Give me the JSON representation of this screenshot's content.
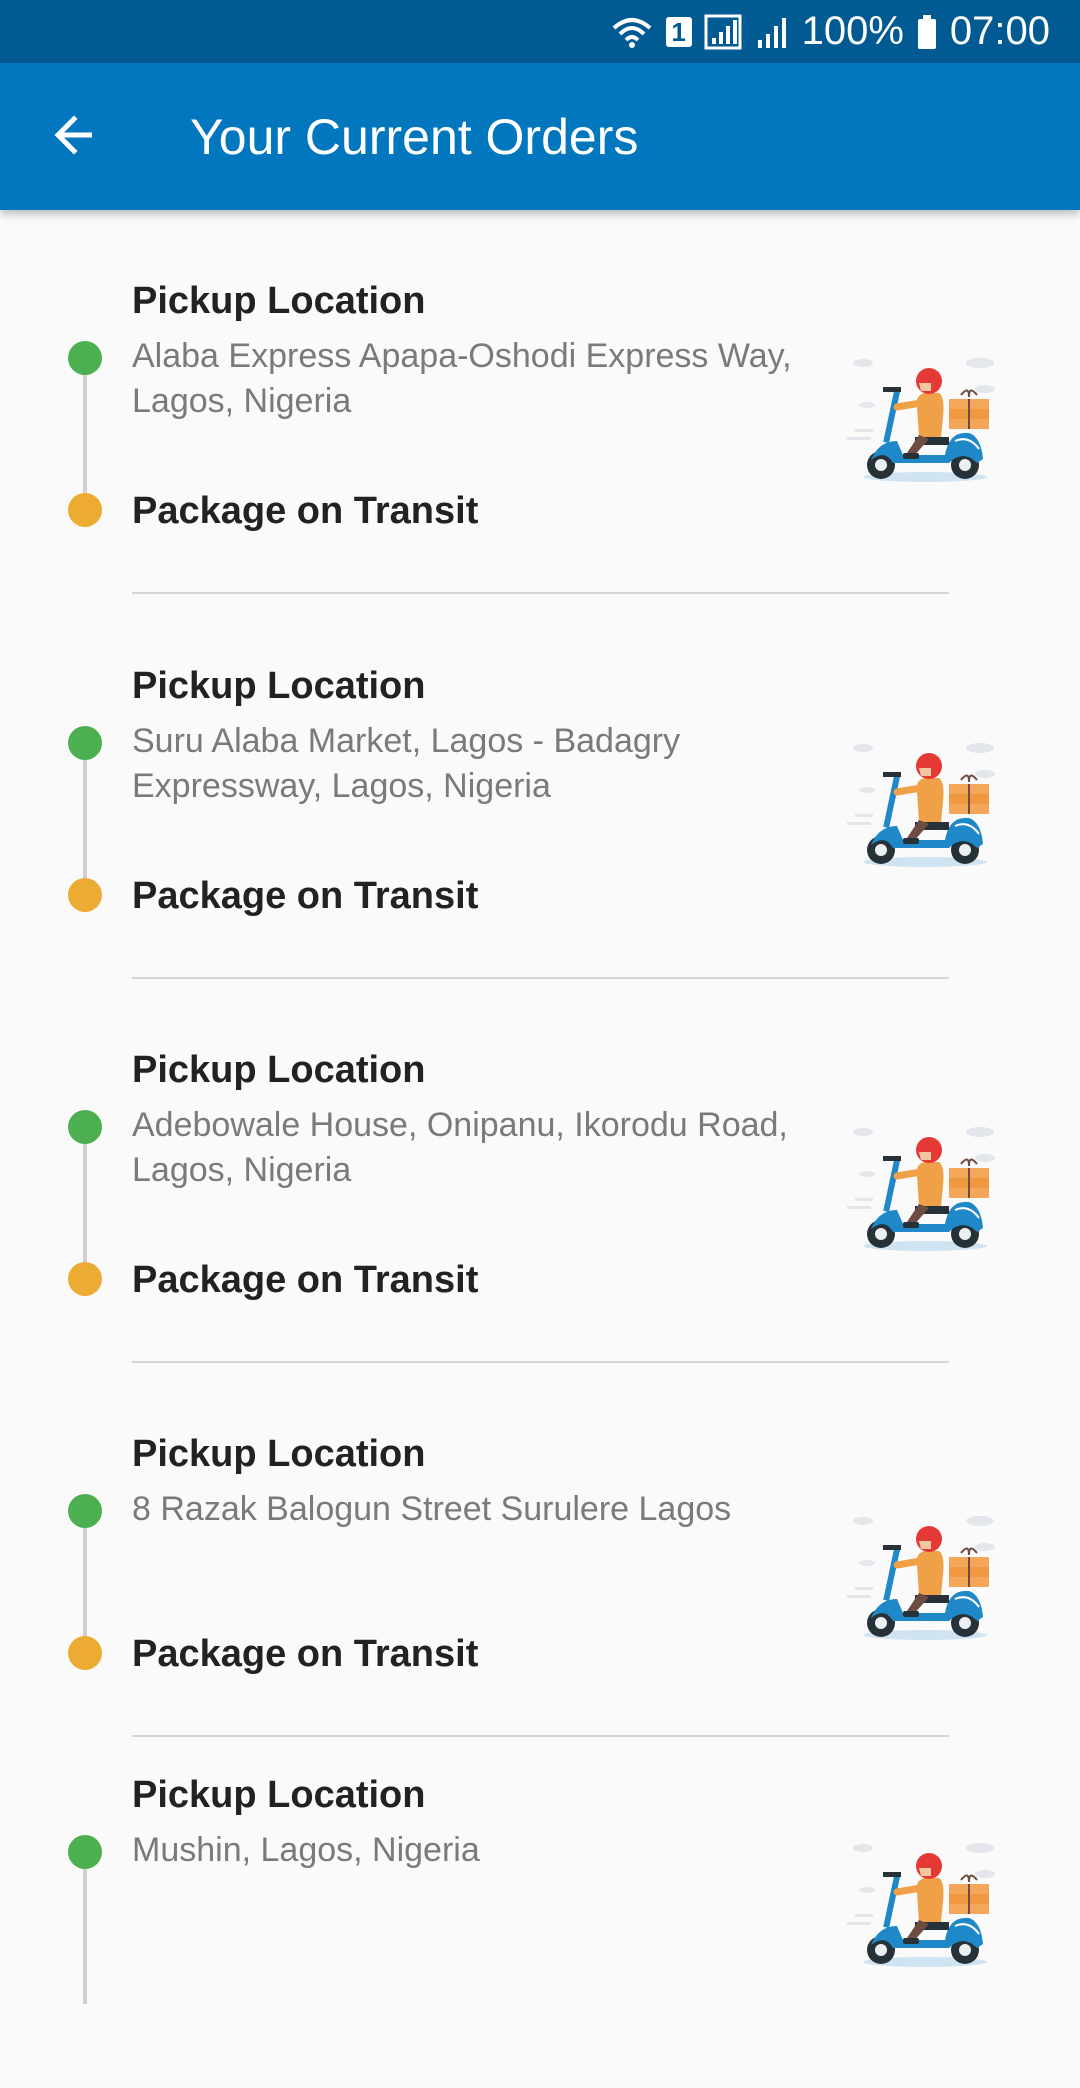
{
  "status_bar": {
    "sim_badge": "1",
    "battery": "100%",
    "time": "07:00"
  },
  "app_bar": {
    "title": "Your Current Orders",
    "back_icon": "arrow-back-icon"
  },
  "colors": {
    "status_bar": "#015a92",
    "app_bar": "#0277bd",
    "pickup_dot": "#4caf50",
    "transit_dot": "#ecac34"
  },
  "orders": [
    {
      "pickup_label": "Pickup Location",
      "address": "Alaba Express Apapa-Oshodi Express Way, Lagos, Nigeria",
      "status": "Package on Transit",
      "illustration": "delivery-scooter-icon"
    },
    {
      "pickup_label": "Pickup Location",
      "address": "Suru Alaba Market, Lagos - Badagry Expressway, Lagos, Nigeria",
      "status": "Package on Transit",
      "illustration": "delivery-scooter-icon"
    },
    {
      "pickup_label": "Pickup Location",
      "address": "Adebowale House, Onipanu, Ikorodu Road, Lagos, Nigeria",
      "status": "Package on Transit",
      "illustration": "delivery-scooter-icon"
    },
    {
      "pickup_label": "Pickup Location",
      "address": "8 Razak Balogun Street Surulere Lagos",
      "status": "Package on Transit",
      "illustration": "delivery-scooter-icon"
    },
    {
      "pickup_label": "Pickup Location",
      "address": "Mushin, Lagos, Nigeria",
      "status": "",
      "illustration": "delivery-scooter-icon"
    }
  ]
}
